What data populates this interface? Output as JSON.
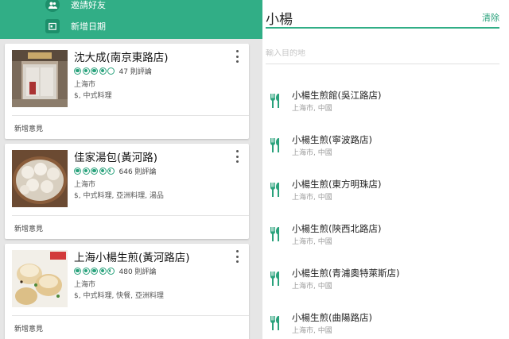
{
  "left_panel": {
    "menu": [
      {
        "label": "邀請好友",
        "icon": "people-icon"
      },
      {
        "label": "新增日期",
        "icon": "calendar-icon"
      }
    ],
    "cards": [
      {
        "title": "沈大成(南京東路店)",
        "rating": 4,
        "reviews": "47 則評論",
        "city": "上海市",
        "category": "$, 中式料理",
        "note": "新增意見"
      },
      {
        "title": "佳家湯包(黃河路)",
        "rating": 4.5,
        "reviews": "646 則評論",
        "city": "上海市",
        "category": "$, 中式料理, 亞洲料理, 湯品",
        "note": "新增意見"
      },
      {
        "title": "上海小楊生煎(黃河路店)",
        "rating": 4.5,
        "reviews": "480 則評論",
        "city": "上海市",
        "category": "$, 中式料理, 快餐, 亞洲料理",
        "note": "新增意見"
      }
    ]
  },
  "right_panel": {
    "search_query": "小楊",
    "clear_label": "清除",
    "destination_placeholder": "輸入目的地",
    "results": [
      {
        "name": "小楊生煎館(吳江路店)",
        "location": "上海市, 中國"
      },
      {
        "name": "小楊生煎(寧波路店)",
        "location": "上海市, 中國"
      },
      {
        "name": "小楊生煎(東方明珠店)",
        "location": "上海市, 中國"
      },
      {
        "name": "小楊生煎(陝西北路店)",
        "location": "上海市, 中國"
      },
      {
        "name": "小楊生煎(青浦奧特萊斯店)",
        "location": "上海市, 中國"
      },
      {
        "name": "小楊生煎(曲陽路店)",
        "location": "上海市, 中國"
      }
    ]
  },
  "colors": {
    "accent": "#31ae86",
    "rating": "#2aa27c"
  }
}
